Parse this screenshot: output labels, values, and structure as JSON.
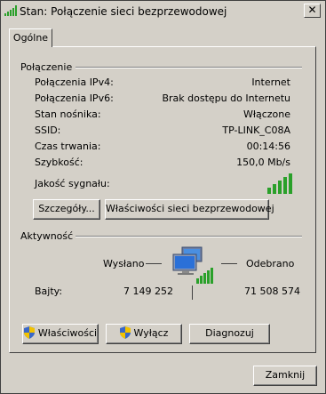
{
  "window": {
    "title": "Stan: Połączenie sieci bezprzewodowej",
    "close_glyph": "✕"
  },
  "tabs": [
    {
      "label": "Ogólne",
      "active": true
    }
  ],
  "connection": {
    "heading": "Połączenie",
    "rows": [
      {
        "label": "Połączenia IPv4:",
        "value": "Internet"
      },
      {
        "label": "Połączenia IPv6:",
        "value": "Brak dostępu do Internetu"
      },
      {
        "label": "Stan nośnika:",
        "value": "Włączone"
      },
      {
        "label": "SSID:",
        "value": "TP-LINK_C08A"
      },
      {
        "label": "Czas trwania:",
        "value": "00:14:56"
      },
      {
        "label": "Szybkość:",
        "value": "150,0 Mb/s"
      }
    ],
    "signal_label": "Jakość sygnału:",
    "signal_bars_lit": 5,
    "signal_bars_total": 5,
    "details_button": "Szczegóły...",
    "wireless_props_button": "Właściwości sieci bezprzewodowej"
  },
  "activity": {
    "heading": "Aktywność",
    "sent_label": "Wysłano",
    "received_label": "Odebrano",
    "bytes_label": "Bajty:",
    "bytes_sent": "7 149 252",
    "bytes_received": "71 508 574"
  },
  "actions": {
    "properties_button": "Właściwości",
    "disable_button": "Wyłącz",
    "diagnose_button": "Diagnozuj"
  },
  "footer": {
    "close_button": "Zamknij"
  },
  "colors": {
    "signal_green": "#2aa02a",
    "dialog_face": "#d4d0c8"
  }
}
